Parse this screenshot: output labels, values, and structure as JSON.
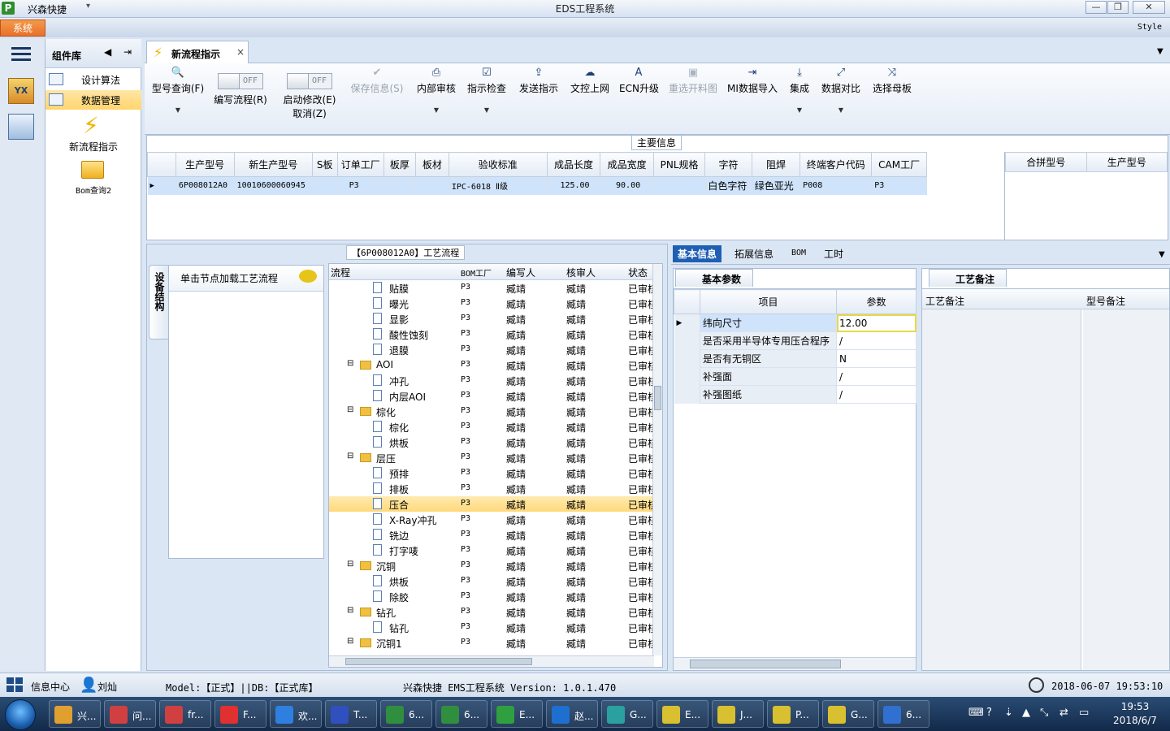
{
  "window": {
    "app_name": "兴森快捷",
    "title": "EDS工程系统",
    "min": "—",
    "max": "❐",
    "close": "✕",
    "system_menu": "系统",
    "style_label": "Style"
  },
  "component_library": {
    "title": "组件库",
    "items": [
      {
        "label": "设计算法",
        "selected": false
      },
      {
        "label": "数据管理",
        "selected": true
      }
    ],
    "tools": [
      {
        "label": "新流程指示",
        "icon": "lightning-icon"
      },
      {
        "label": "Bom查询2",
        "icon": "folder-icon"
      }
    ]
  },
  "doc_tab": {
    "label": "新流程指示",
    "close": "×"
  },
  "ribbon": {
    "buttons": [
      {
        "label": "型号查询(F)",
        "icon": "🔍",
        "dropdown": true,
        "disabled": false
      },
      {
        "label": "编写流程(R)",
        "toggle": "OFF",
        "disabled": false
      },
      {
        "label": "启动修改(E)",
        "sublabel": "取消(Z)",
        "toggle": "OFF",
        "disabled": false
      },
      {
        "label": "保存信息(S)",
        "icon": "✔",
        "disabled": true
      },
      {
        "label": "内部审核",
        "icon": "⎙",
        "dropdown": true,
        "disabled": false
      },
      {
        "label": "指示检查",
        "icon": "☑",
        "dropdown": true,
        "disabled": false
      },
      {
        "label": "发送指示",
        "icon": "⇪",
        "disabled": false
      },
      {
        "label": "文控上网",
        "icon": "☁",
        "disabled": false
      },
      {
        "label": "ECN升级",
        "icon": "A",
        "disabled": false
      },
      {
        "label": "重选开料图",
        "icon": "▣",
        "disabled": true
      },
      {
        "label": "MI数据导入",
        "icon": "⇥",
        "disabled": false
      },
      {
        "label": "集成",
        "icon": "⤓",
        "dropdown": true,
        "disabled": false
      },
      {
        "label": "数据对比",
        "icon": "⤢",
        "dropdown": true,
        "disabled": false
      },
      {
        "label": "选择母板",
        "icon": "⤨",
        "disabled": false
      }
    ]
  },
  "main_info": {
    "title": "主要信息",
    "columns": [
      "生产型号",
      "新生产型号",
      "S板",
      "订单工厂",
      "板厚",
      "板材",
      "验收标准",
      "成品长度",
      "成品宽度",
      "PNL规格",
      "字符",
      "阻焊",
      "终端客户代码",
      "CAM工厂"
    ],
    "rows": [
      [
        "6P008012A0",
        "10010600060945",
        "",
        "P3",
        "",
        "",
        "IPC-6018 Ⅱ级",
        "125.00",
        "90.00",
        "",
        "白色字符",
        "绿色亚光",
        "P008",
        "P3"
      ]
    ],
    "side_columns": [
      "合拼型号",
      "生产型号"
    ]
  },
  "flow": {
    "title": "【6P008012A0】工艺流程",
    "side_tab": "设备结构",
    "nav_hint": "单击节点加载工艺流程",
    "columns": [
      "流程",
      "BOM工厂",
      "编写人",
      "核审人",
      "状态"
    ],
    "rows": [
      {
        "level": 2,
        "type": "doc",
        "name": "贴膜",
        "factory": "P3",
        "writer": "臧靖",
        "reviewer": "臧靖",
        "status": "已审核"
      },
      {
        "level": 2,
        "type": "doc",
        "name": "曝光",
        "factory": "P3",
        "writer": "臧靖",
        "reviewer": "臧靖",
        "status": "已审核"
      },
      {
        "level": 2,
        "type": "doc",
        "name": "显影",
        "factory": "P3",
        "writer": "臧靖",
        "reviewer": "臧靖",
        "status": "已审核"
      },
      {
        "level": 2,
        "type": "doc",
        "name": "酸性蚀刻",
        "factory": "P3",
        "writer": "臧靖",
        "reviewer": "臧靖",
        "status": "已审核"
      },
      {
        "level": 2,
        "type": "doc",
        "name": "退膜",
        "factory": "P3",
        "writer": "臧靖",
        "reviewer": "臧靖",
        "status": "已审核"
      },
      {
        "level": 1,
        "type": "folder",
        "name": "AOI",
        "factory": "P3",
        "writer": "臧靖",
        "reviewer": "臧靖",
        "status": "已审核"
      },
      {
        "level": 2,
        "type": "doc",
        "name": "冲孔",
        "factory": "P3",
        "writer": "臧靖",
        "reviewer": "臧靖",
        "status": "已审核"
      },
      {
        "level": 2,
        "type": "doc",
        "name": "内层AOI",
        "factory": "P3",
        "writer": "臧靖",
        "reviewer": "臧靖",
        "status": "已审核"
      },
      {
        "level": 1,
        "type": "folder",
        "name": "棕化",
        "factory": "P3",
        "writer": "臧靖",
        "reviewer": "臧靖",
        "status": "已审核"
      },
      {
        "level": 2,
        "type": "doc",
        "name": "棕化",
        "factory": "P3",
        "writer": "臧靖",
        "reviewer": "臧靖",
        "status": "已审核"
      },
      {
        "level": 2,
        "type": "doc",
        "name": "烘板",
        "factory": "P3",
        "writer": "臧靖",
        "reviewer": "臧靖",
        "status": "已审核"
      },
      {
        "level": 1,
        "type": "folder",
        "name": "层压",
        "factory": "P3",
        "writer": "臧靖",
        "reviewer": "臧靖",
        "status": "已审核"
      },
      {
        "level": 2,
        "type": "doc",
        "name": "预排",
        "factory": "P3",
        "writer": "臧靖",
        "reviewer": "臧靖",
        "status": "已审核"
      },
      {
        "level": 2,
        "type": "doc",
        "name": "排板",
        "factory": "P3",
        "writer": "臧靖",
        "reviewer": "臧靖",
        "status": "已审核"
      },
      {
        "level": 2,
        "type": "doc",
        "name": "压合",
        "factory": "P3",
        "writer": "臧靖",
        "reviewer": "臧靖",
        "status": "已审核",
        "selected": true
      },
      {
        "level": 2,
        "type": "doc",
        "name": "X-Ray冲孔",
        "factory": "P3",
        "writer": "臧靖",
        "reviewer": "臧靖",
        "status": "已审核"
      },
      {
        "level": 2,
        "type": "doc",
        "name": "铣边",
        "factory": "P3",
        "writer": "臧靖",
        "reviewer": "臧靖",
        "status": "已审核"
      },
      {
        "level": 2,
        "type": "doc",
        "name": "打字唛",
        "factory": "P3",
        "writer": "臧靖",
        "reviewer": "臧靖",
        "status": "已审核"
      },
      {
        "level": 1,
        "type": "folder",
        "name": "沉铜",
        "factory": "P3",
        "writer": "臧靖",
        "reviewer": "臧靖",
        "status": "已审核"
      },
      {
        "level": 2,
        "type": "doc",
        "name": "烘板",
        "factory": "P3",
        "writer": "臧靖",
        "reviewer": "臧靖",
        "status": "已审核"
      },
      {
        "level": 2,
        "type": "doc",
        "name": "除胶",
        "factory": "P3",
        "writer": "臧靖",
        "reviewer": "臧靖",
        "status": "已审核"
      },
      {
        "level": 1,
        "type": "folder",
        "name": "钻孔",
        "factory": "P3",
        "writer": "臧靖",
        "reviewer": "臧靖",
        "status": "已审核"
      },
      {
        "level": 2,
        "type": "doc",
        "name": "钻孔",
        "factory": "P3",
        "writer": "臧靖",
        "reviewer": "臧靖",
        "status": "已审核"
      },
      {
        "level": 1,
        "type": "folder",
        "name": "沉铜1",
        "factory": "P3",
        "writer": "臧靖",
        "reviewer": "臧靖",
        "status": "已审核"
      }
    ]
  },
  "right_tabs": [
    "基本信息",
    "拓展信息",
    "BOM",
    "工时"
  ],
  "basic_params": {
    "title": "基本参数",
    "columns": [
      "项目",
      "参数"
    ],
    "rows": [
      {
        "item": "纬向尺寸",
        "value": "12.00",
        "selected": true
      },
      {
        "item": "是否采用半导体专用压合程序",
        "value": "/"
      },
      {
        "item": "是否有无铜区",
        "value": "N"
      },
      {
        "item": "补强面",
        "value": "/"
      },
      {
        "item": "补强图纸",
        "value": "/"
      }
    ]
  },
  "process_notes": {
    "title": "工艺备注",
    "columns": [
      "工艺备注",
      "型号备注"
    ]
  },
  "status_bar": {
    "info_center": "信息中心",
    "user": "刘灿",
    "model": "Model:【正式】||DB:【正式库】",
    "version": "兴森快捷 EMS工程系统 Version: 1.0.1.470",
    "datetime": "2018-06-07 19:53:10"
  },
  "taskbar": {
    "items": [
      {
        "label": "兴...",
        "color": "#e0a030"
      },
      {
        "label": "问...",
        "color": "#d04040"
      },
      {
        "label": "fr...",
        "color": "#d04040"
      },
      {
        "label": "F...",
        "color": "#e03030"
      },
      {
        "label": "欢...",
        "color": "#2f7fe0"
      },
      {
        "label": "T...",
        "color": "#3050c0"
      },
      {
        "label": "6...",
        "color": "#2f8f3f"
      },
      {
        "label": "6...",
        "color": "#2f8f3f"
      },
      {
        "label": "E...",
        "color": "#2f9f3f"
      },
      {
        "label": "赵...",
        "color": "#1e6fd0"
      },
      {
        "label": "G...",
        "color": "#2aa0a0"
      },
      {
        "label": "E...",
        "color": "#d8c030"
      },
      {
        "label": "J...",
        "color": "#d8c030"
      },
      {
        "label": "P...",
        "color": "#d8c030"
      },
      {
        "label": "G...",
        "color": "#d8c030"
      },
      {
        "label": "6...",
        "color": "#3070d0"
      }
    ],
    "time": "19:53",
    "date": "2018/6/7"
  }
}
